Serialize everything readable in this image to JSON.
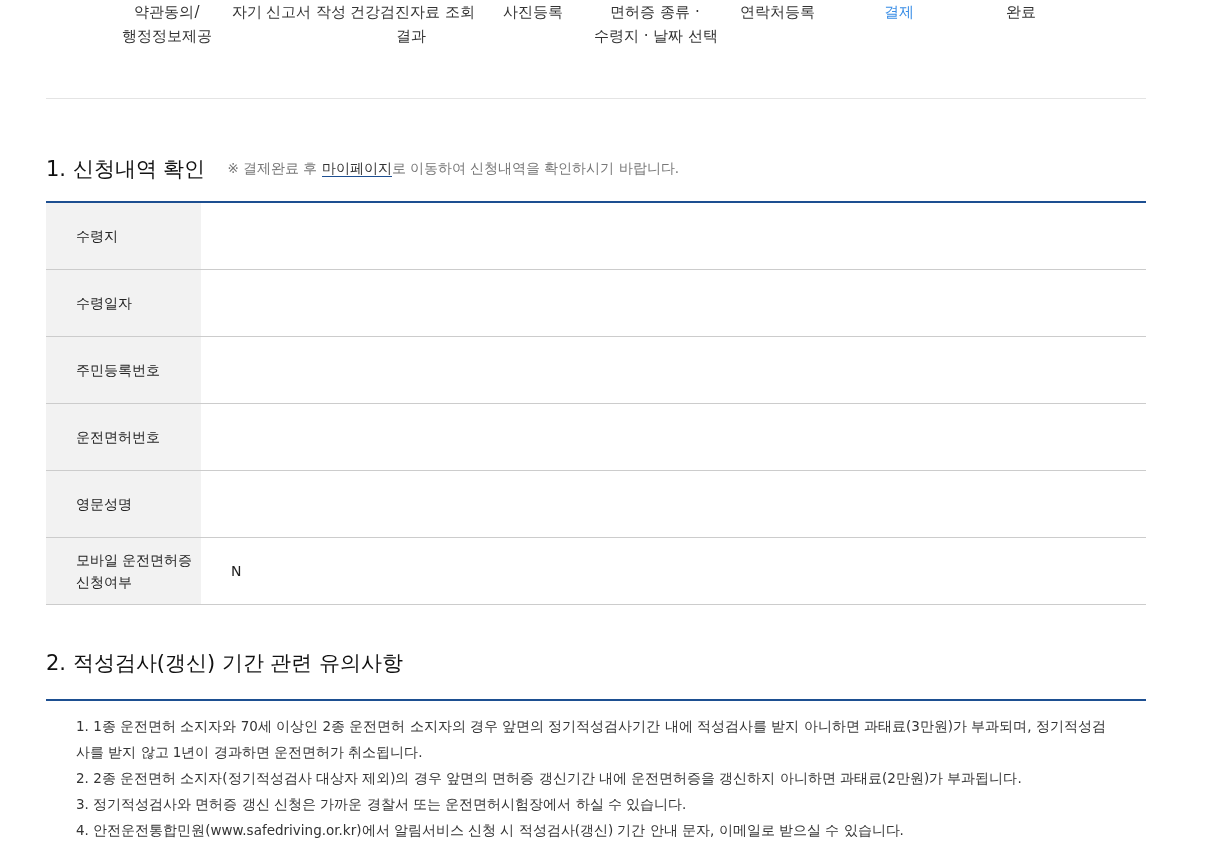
{
  "steps": [
    {
      "label": "약관동의/\n행정정보제공",
      "selected": false
    },
    {
      "label": "자기 신고서 작성",
      "selected": false
    },
    {
      "label": "건강검진자료 조회\n결과",
      "selected": false
    },
    {
      "label": "사진등록",
      "selected": false
    },
    {
      "label": "면허증 종류 ·\n수령지 · 날짜 선택",
      "selected": false
    },
    {
      "label": "연락처등록",
      "selected": false
    },
    {
      "label": "결제",
      "selected": true
    },
    {
      "label": "완료",
      "selected": false
    }
  ],
  "application_summary": {
    "title": "1. 신청내역 확인",
    "note_before": "※ 결제완료 후 ",
    "note_link": "마이페이지",
    "note_after": "로 이동하여 신청내역을 확인하시기 바랍니다.",
    "rows": [
      {
        "label": "수령지"
      },
      {
        "label": "수령일자"
      },
      {
        "label": "주민등록번호"
      },
      {
        "label": "운전면허번호"
      },
      {
        "label": "영문성명"
      },
      {
        "label": "모바일 운전면허증\n신청여부",
        "value": "N"
      }
    ]
  },
  "notices": {
    "title": "2. 적성검사(갱신) 기간 관련 유의사항",
    "items": [
      "1. 1종 운전면허 소지자와 70세 이상인 2종 운전면허 소지자의 경우 앞면의 정기적성검사기간 내에 적성검사를 받지 아니하면 과태료(3만원)가 부과되며, 정기적성검사를 받지 않고 1년이 경과하면 운전면허가 취소됩니다.",
      "2. 2종 운전면허 소지자(정기적성검사 대상자 제외)의 경우 앞면의 면허증 갱신기간 내에 운전면허증을 갱신하지 아니하면 과태료(2만원)가 부과됩니다.",
      "3. 정기적성검사와 면허증 갱신 신청은 가까운 경찰서 또는 운전면허시험장에서 하실 수 있습니다.",
      "4. 안전운전통합민원(www.safedriving.or.kr)에서 알림서비스 신청 시 적성검사(갱신) 기간 안내 문자, 이메일로 받으실 수 있습니다."
    ]
  }
}
